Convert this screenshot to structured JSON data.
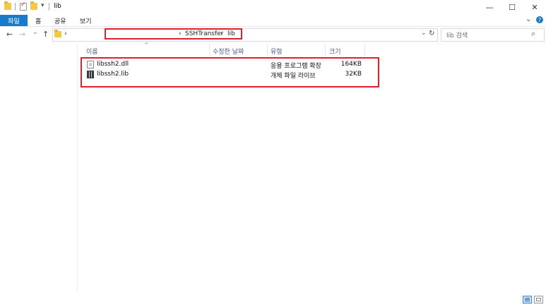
{
  "window": {
    "title": "lib",
    "controls": {
      "minimize": "—",
      "maximize": "☐",
      "close": "✕"
    },
    "quick_access": [
      "folder-icon",
      "properties-check-icon",
      "new-folder-icon",
      "customize-dropdown-icon"
    ]
  },
  "ribbon": {
    "tabs": [
      "파일",
      "홈",
      "공유",
      "보기"
    ],
    "expand_glyph": "⌄",
    "help_glyph": "?"
  },
  "nav": {
    "back": "←",
    "forward": "→",
    "recent": "⌄",
    "up": "↑"
  },
  "address": {
    "leading_chevron": "›",
    "crumbs": [
      "SSHTransfer",
      "lib"
    ],
    "crumb_separator": "›",
    "dropdown": "⌄",
    "refresh": "↻"
  },
  "search": {
    "placeholder": "lib 검색",
    "icon": "search-icon"
  },
  "columns": {
    "name": "이름",
    "modified": "수정한 날짜",
    "type": "유형",
    "size": "크기",
    "sort_indicator": "^"
  },
  "files": [
    {
      "name": "libssh2.dll",
      "modified": "",
      "type": "응용 프로그램 확장",
      "size": "164KB",
      "icon": "dll-file-icon"
    },
    {
      "name": "libssh2.lib",
      "modified": "",
      "type": "개체 파일 라이브",
      "size": "32KB",
      "icon": "library-file-icon"
    }
  ],
  "highlight_color": "#e0202a",
  "accent_color": "#1979ca"
}
